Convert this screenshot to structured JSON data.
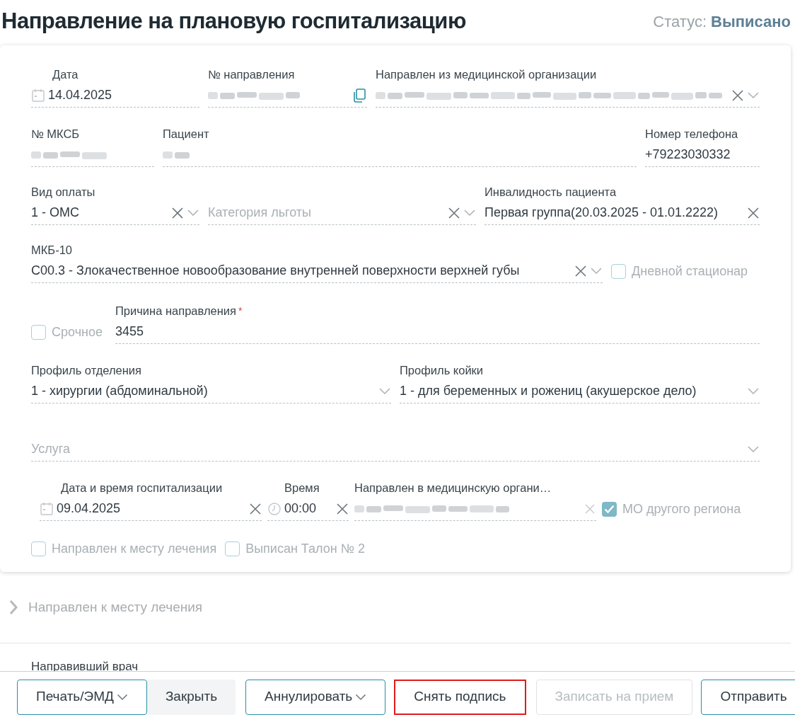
{
  "title": "Направление на плановую госпитализацию",
  "status": {
    "label": "Статус:",
    "value": "Выписано"
  },
  "rows": [
    [
      {
        "kind": "field",
        "label": "Дата",
        "value": "14.04.2025",
        "date_picker": true,
        "clear": false,
        "dropdown": false,
        "copy": false,
        "redacted": false
      },
      {
        "kind": "field",
        "label": "№ направления",
        "clear": false,
        "dropdown": false,
        "copy": true,
        "redacted": true
      },
      {
        "kind": "field",
        "label": "Направлен из медицинской организации",
        "clear": true,
        "dropdown": true,
        "copy": false,
        "redacted": true
      }
    ],
    [
      {
        "kind": "field",
        "label": "№ МКСБ",
        "clear": false,
        "dropdown": false,
        "copy": false,
        "redacted": true
      },
      {
        "kind": "field",
        "label": "Пациент",
        "clear": false,
        "dropdown": false,
        "copy": false,
        "redacted": true
      },
      {
        "kind": "field",
        "label": "Номер телефона",
        "value": "+79223030332",
        "clear": false,
        "dropdown": false,
        "copy": false,
        "redacted": false
      }
    ],
    [
      {
        "kind": "field",
        "label": "Вид оплаты",
        "value": "1 - ОМС",
        "clear": true,
        "dropdown": true,
        "copy": false,
        "redacted": false
      },
      {
        "kind": "field",
        "placeholder": "Категория льготы",
        "clear": true,
        "dropdown": true,
        "copy": false,
        "redacted": false
      },
      {
        "kind": "field",
        "label": "Инвалидность пациента",
        "value": "Первая группа(20.03.2025 - 01.01.2222)",
        "clear": true,
        "dropdown": false,
        "copy": false,
        "redacted": false
      }
    ],
    [
      {
        "kind": "field",
        "label": "МКБ-10",
        "value": "C00.3 - Злокачественное новообразование внутренней поверхности верхней губы",
        "clear": true,
        "dropdown": true,
        "copy": false,
        "redacted": false
      },
      {
        "kind": "checkbox",
        "label": "Дневной стационар",
        "checked": false
      }
    ],
    [
      {
        "kind": "checkbox",
        "label": "Срочное",
        "checked": false
      },
      {
        "kind": "field",
        "label": "Причина направления",
        "required_mark": "*",
        "value": "3455",
        "clear": false,
        "dropdown": false,
        "copy": false,
        "redacted": false
      }
    ],
    [
      {
        "kind": "field",
        "label": "Профиль отделения",
        "value": "1 - хирургии (абдоминальной)",
        "clear": false,
        "dropdown": true,
        "copy": false,
        "redacted": false
      },
      {
        "kind": "field",
        "label": "Профиль койки",
        "value": "1 - для беременных и рожениц (акушерское дело)",
        "clear": false,
        "dropdown": true,
        "copy": false,
        "redacted": false
      }
    ],
    [
      {
        "kind": "field",
        "placeholder": "Услуга",
        "clear": false,
        "dropdown": true,
        "copy": false,
        "redacted": false
      }
    ],
    [
      {
        "kind": "field",
        "label": "Дата и время госпитализации",
        "value": "09.04.2025",
        "date_picker": true,
        "clear": true,
        "dropdown": false,
        "copy": false,
        "redacted": false
      },
      {
        "kind": "field",
        "label": "Время",
        "value": "00:00",
        "time_picker": true,
        "clear": true,
        "dropdown": false,
        "copy": false,
        "redacted": false
      },
      {
        "kind": "field",
        "label": "Направлен в медицинскую органи…",
        "clear": true,
        "dropdown": false,
        "copy": false,
        "redacted": true,
        "disabled": true
      },
      {
        "kind": "checkbox",
        "label": "МО другого региона",
        "checked": true
      }
    ],
    [
      {
        "kind": "checkbox",
        "label": "Направлен к месту лечения",
        "checked": false
      },
      {
        "kind": "checkbox",
        "label": "Выписан Талон № 2",
        "checked": false
      }
    ]
  ],
  "section": {
    "label": "Направлен к месту лечения",
    "expanded": false
  },
  "next_section": "Направивший врач",
  "buttons": [
    {
      "label": "Печать/ЭМД",
      "kind": "outline",
      "dropdown": true
    },
    {
      "label": "Закрыть",
      "kind": "plain",
      "dropdown": false
    },
    {
      "label": "Аннулировать",
      "kind": "outline",
      "dropdown": true
    },
    {
      "label": "Снять подпись",
      "kind": "highlighted",
      "dropdown": false
    },
    {
      "label": "Записать на прием",
      "kind": "disabled",
      "dropdown": false
    },
    {
      "label": "Отправить",
      "kind": "outline",
      "dropdown": false
    }
  ]
}
